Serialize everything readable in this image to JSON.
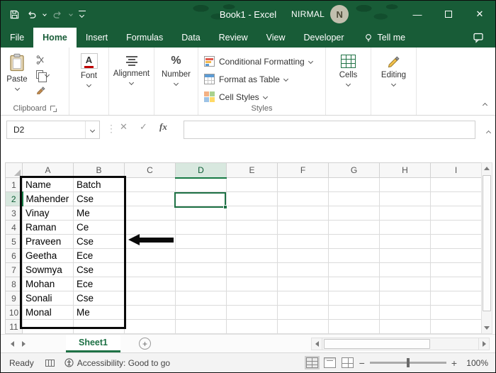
{
  "window": {
    "title": "Book1 - Excel",
    "user_name": "NIRMAL",
    "avatar_initial": "N"
  },
  "menu": {
    "tabs": [
      "File",
      "Home",
      "Insert",
      "Formulas",
      "Data",
      "Review",
      "View",
      "Developer"
    ],
    "active_tab": "Home",
    "tell_me": "Tell me"
  },
  "ribbon": {
    "clipboard": {
      "label": "Clipboard",
      "paste_label": "Paste"
    },
    "font": {
      "label": "Font"
    },
    "alignment": {
      "label": "Alignment"
    },
    "number": {
      "label": "Number"
    },
    "styles": {
      "label": "Styles",
      "items": [
        "Conditional Formatting",
        "Format as Table",
        "Cell Styles"
      ]
    },
    "cells": {
      "label": "Cells"
    },
    "editing": {
      "label": "Editing"
    }
  },
  "formula_bar": {
    "name_box": "D2",
    "fx": "fx"
  },
  "grid": {
    "column_headers": [
      "A",
      "B",
      "C",
      "D",
      "E",
      "F",
      "G",
      "H",
      "I"
    ],
    "row_headers": [
      "1",
      "2",
      "3",
      "4",
      "5",
      "6",
      "7",
      "8",
      "9",
      "10",
      "11"
    ],
    "selected_column": "D",
    "selected_row": "2",
    "selected_cell": "D2",
    "cells": [
      [
        "Name",
        "Batch"
      ],
      [
        "Mahender",
        "Cse"
      ],
      [
        "Vinay",
        "Me"
      ],
      [
        "Raman",
        "Ce"
      ],
      [
        "Praveen",
        "Cse"
      ],
      [
        "Geetha",
        "Ece"
      ],
      [
        "Sowmya",
        "Cse"
      ],
      [
        "Mohan",
        "Ece"
      ],
      [
        "Sonali",
        "Cse"
      ],
      [
        "Monal",
        "Me"
      ]
    ]
  },
  "sheet_bar": {
    "sheet_name": "Sheet1"
  },
  "status_bar": {
    "mode": "Ready",
    "accessibility": "Accessibility: Good to go",
    "zoom": "100%"
  },
  "icons": {
    "minimize": "—",
    "close": "✕",
    "cancel": "✕",
    "enter": "✓",
    "percent": "%",
    "font_letter": "A",
    "plus_sheet": "+",
    "zoom_minus": "−",
    "zoom_plus": "+",
    "ellipsis_vertical": "⋮"
  },
  "colors": {
    "excel_green_dark": "#185C37",
    "excel_green": "#217346",
    "selection_border": "#1E7145",
    "annotation": "#0a0a0a"
  }
}
